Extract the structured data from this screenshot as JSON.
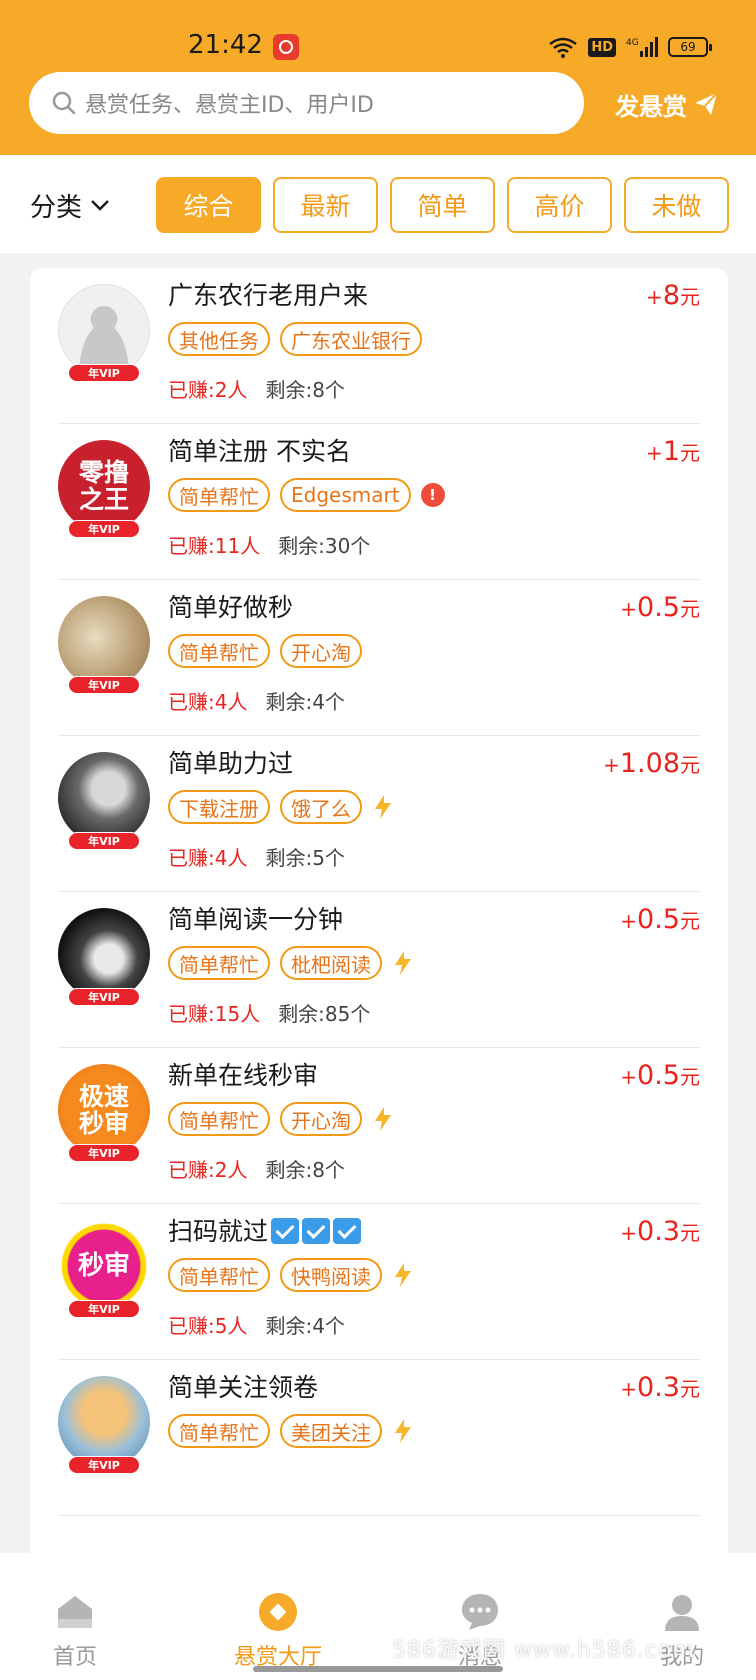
{
  "status_bar": {
    "time": "21:42",
    "battery": "69",
    "network": "4G",
    "hd": "HD"
  },
  "search": {
    "placeholder": "悬赏任务、悬赏主ID、用户ID"
  },
  "publish_button": {
    "label": "发悬赏"
  },
  "filter": {
    "category_label": "分类",
    "tabs": [
      {
        "label": "综合",
        "active": true
      },
      {
        "label": "最新",
        "active": false
      },
      {
        "label": "简单",
        "active": false
      },
      {
        "label": "高价",
        "active": false
      },
      {
        "label": "未做",
        "active": false
      }
    ]
  },
  "vip_label": "年VIP",
  "tasks": [
    {
      "title": "广东农行老用户来",
      "reward_plus": "+",
      "reward_amount": "8",
      "reward_unit": "元",
      "tags": [
        "其他任务",
        "广东农业银行"
      ],
      "extra": "",
      "earned": "已赚:2人",
      "remaining": "剩余:8个",
      "avatar_style": "gray",
      "avatar_text": ""
    },
    {
      "title": "简单注册 不实名",
      "reward_plus": "+",
      "reward_amount": "1",
      "reward_unit": "元",
      "tags": [
        "简单帮忙",
        "Edgesmart"
      ],
      "extra": "alert",
      "earned": "已赚:11人",
      "remaining": "剩余:30个",
      "avatar_style": "red",
      "avatar_text": "零撸之王"
    },
    {
      "title": "简单好做秒",
      "reward_plus": "+",
      "reward_amount": "0.5",
      "reward_unit": "元",
      "tags": [
        "简单帮忙",
        "开心淘"
      ],
      "extra": "",
      "earned": "已赚:4人",
      "remaining": "剩余:4个",
      "avatar_style": "cat",
      "avatar_text": ""
    },
    {
      "title": "简单助力过",
      "reward_plus": "+",
      "reward_amount": "1.08",
      "reward_unit": "元",
      "tags": [
        "下载注册",
        "饿了么"
      ],
      "extra": "bolt",
      "earned": "已赚:4人",
      "remaining": "剩余:5个",
      "avatar_style": "dark",
      "avatar_text": ""
    },
    {
      "title": "简单阅读一分钟",
      "reward_plus": "+",
      "reward_amount": "0.5",
      "reward_unit": "元",
      "tags": [
        "简单帮忙",
        "枇杷阅读"
      ],
      "extra": "bolt",
      "earned": "已赚:15人",
      "remaining": "剩余:85个",
      "avatar_style": "black",
      "avatar_text": ""
    },
    {
      "title": "新单在线秒审",
      "reward_plus": "+",
      "reward_amount": "0.5",
      "reward_unit": "元",
      "tags": [
        "简单帮忙",
        "开心淘"
      ],
      "extra": "bolt",
      "earned": "已赚:2人",
      "remaining": "剩余:8个",
      "avatar_style": "orange",
      "avatar_text": "极速秒审"
    },
    {
      "title": "扫码就过",
      "title_checks": 3,
      "reward_plus": "+",
      "reward_amount": "0.3",
      "reward_unit": "元",
      "tags": [
        "简单帮忙",
        "快鸭阅读"
      ],
      "extra": "bolt",
      "earned": "已赚:5人",
      "remaining": "剩余:4个",
      "avatar_style": "pink",
      "avatar_text": "秒审"
    },
    {
      "title": "简单关注领卷",
      "reward_plus": "+",
      "reward_amount": "0.3",
      "reward_unit": "元",
      "tags": [
        "简单帮忙",
        "美团关注"
      ],
      "extra": "bolt",
      "earned": "",
      "remaining": "",
      "avatar_style": "tiger",
      "avatar_text": ""
    }
  ],
  "bottom_nav": [
    {
      "label": "首页",
      "icon": "home-icon",
      "active": false
    },
    {
      "label": "悬赏大厅",
      "icon": "reward-hall-icon",
      "active": true
    },
    {
      "label": "消息",
      "icon": "chat-icon",
      "active": false
    },
    {
      "label": "我的",
      "icon": "profile-icon",
      "active": false
    }
  ],
  "watermark": "586游戏网 www.h586.com",
  "colors": {
    "brand": "#f7a928",
    "reward_red": "#e8241f",
    "tag_orange": "#e8741a"
  }
}
